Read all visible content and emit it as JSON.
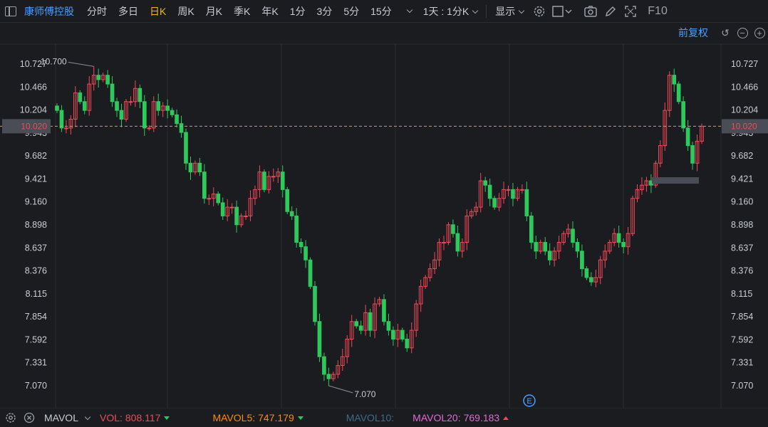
{
  "toolbar": {
    "stock_name": "康师傅控股",
    "periods": [
      "分时",
      "多日",
      "日K",
      "周K",
      "月K",
      "季K",
      "年K",
      "1分",
      "3分",
      "5分",
      "15分"
    ],
    "active_period": "日K",
    "interval_label": "1天 : 1分K",
    "display_label": "显示",
    "f10_label": "F10"
  },
  "adjust": {
    "label": "前复权"
  },
  "axis": {
    "ticks": [
      "10.727",
      "10.466",
      "10.204",
      "9.943",
      "9.682",
      "9.421",
      "9.160",
      "8.898",
      "8.637",
      "8.376",
      "8.115",
      "7.854",
      "7.592",
      "7.331",
      "7.070"
    ],
    "current_price": "10.020",
    "high_annotation": "10.700",
    "low_annotation": "7.070",
    "event_marker": "E"
  },
  "indicator_bar": {
    "name": "MAVOL",
    "vol_label": "VOL:",
    "vol_value": "808.117",
    "mavol5_label": "MAVOL5:",
    "mavol5_value": "747.179",
    "mavol10_label": "MAVOL10:",
    "mavol20_label": "MAVOL20:",
    "mavol20_value": "769.183"
  },
  "colors": {
    "up": "#f24957",
    "down": "#2ec95c",
    "accent": "#4a9eff",
    "active_tab": "#f0b90b",
    "grid": "#2a2c31",
    "price_line": "#c9a25e",
    "vol": "#f24957",
    "mavol5": "#ff8a00",
    "mavol10": "#3d6a8a",
    "mavol20": "#e06bd3"
  },
  "chart_data": {
    "type": "candlestick",
    "ylim": [
      7.07,
      10.727
    ],
    "y_ticks": [
      10.727,
      10.466,
      10.204,
      9.943,
      9.682,
      9.421,
      9.16,
      8.898,
      8.637,
      8.376,
      8.115,
      7.854,
      7.592,
      7.331,
      7.07
    ],
    "current_price": 10.02,
    "high": 10.7,
    "low": 7.07,
    "closes": [
      10.2,
      10.0,
      10.0,
      10.1,
      10.4,
      10.3,
      10.2,
      10.5,
      10.6,
      10.55,
      10.6,
      10.5,
      10.3,
      10.2,
      10.1,
      10.3,
      10.3,
      10.45,
      10.3,
      10.0,
      10.0,
      10.3,
      10.2,
      10.25,
      10.2,
      10.15,
      10.05,
      9.95,
      9.6,
      9.5,
      9.6,
      9.5,
      9.2,
      9.2,
      9.25,
      9.15,
      9.0,
      9.1,
      9.1,
      8.9,
      9.0,
      9.0,
      9.2,
      9.3,
      9.5,
      9.3,
      9.45,
      9.45,
      9.5,
      9.3,
      9.05,
      9.0,
      8.7,
      8.65,
      8.5,
      8.2,
      7.8,
      7.4,
      7.2,
      7.15,
      7.2,
      7.3,
      7.4,
      7.6,
      7.8,
      7.75,
      7.7,
      7.9,
      7.7,
      8.0,
      8.05,
      7.8,
      7.7,
      7.6,
      7.7,
      7.6,
      7.5,
      7.7,
      8.0,
      8.2,
      8.3,
      8.4,
      8.5,
      8.7,
      8.7,
      8.9,
      8.8,
      8.6,
      8.7,
      9.0,
      9.05,
      9.1,
      9.4,
      9.35,
      9.2,
      9.1,
      9.2,
      9.3,
      9.3,
      9.2,
      9.3,
      9.3,
      9.0,
      8.7,
      8.6,
      8.7,
      8.6,
      8.5,
      8.6,
      8.7,
      8.8,
      8.85,
      8.7,
      8.6,
      8.4,
      8.3,
      8.25,
      8.3,
      8.5,
      8.6,
      8.7,
      8.8,
      8.7,
      8.65,
      8.8,
      9.2,
      9.3,
      9.35,
      9.4,
      9.35,
      9.6,
      9.8,
      10.2,
      10.6,
      10.5,
      10.3,
      10.0,
      9.8,
      9.6,
      9.85,
      10.02
    ]
  }
}
